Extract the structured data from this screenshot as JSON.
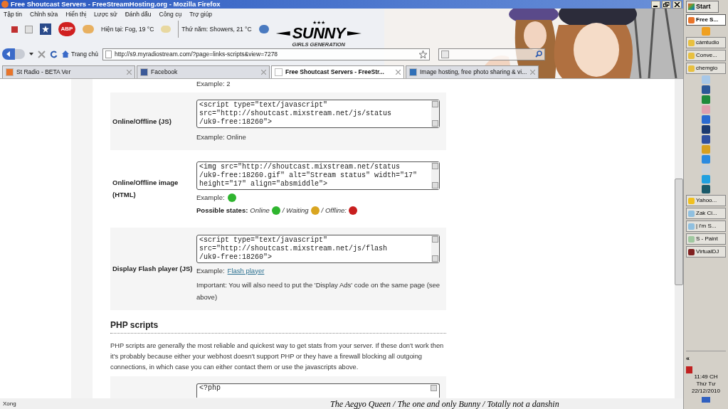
{
  "window": {
    "title": "Free Shoutcast Servers - FreeStreamHosting.org - Mozilla Firefox"
  },
  "menu": [
    "Tập tin",
    "Chỉnh sửa",
    "Hiển thị",
    "Lược sử",
    "Đánh dấu",
    "Công cụ",
    "Trợ giúp"
  ],
  "toolbar": {
    "adblock": "ABP",
    "weather_now": "Hiện tại: Fog, 19 °C",
    "weather_tomorrow": "Thứ năm: Showers, 21 °C"
  },
  "logo": {
    "stars": "★★★",
    "name": "SUNNY",
    "tagline": "GIRLS GENERATION"
  },
  "nav": {
    "home": "Trang chủ",
    "url": "http://s9.myradiostream.com/?page=links-scripts&view=7278"
  },
  "tabs": [
    {
      "label": "St Radio - BETA Ver",
      "selected": false,
      "color": "#e8742a"
    },
    {
      "label": "Facebook",
      "selected": false,
      "color": "#3b5998"
    },
    {
      "label": "Free Shoutcast Servers - FreeStr...",
      "selected": true,
      "color": "#ffffff"
    },
    {
      "label": "Image hosting, free photo sharing & vi...",
      "selected": false,
      "color": "#2f6fb8"
    }
  ],
  "page": {
    "top_note": "Example: 2",
    "rows": [
      {
        "label": "Online/Offline (JS)",
        "code": [
          "<script type=\"text/javascript\"",
          "src=\"http://shoutcast.mixstream.net/js/status",
          "/uk9-free:18260\">"
        ],
        "notes": [
          {
            "kind": "text",
            "text": "Example: Online"
          }
        ]
      },
      {
        "label": "Online/Offline image (HTML)",
        "code": [
          "<img src=\"http://shoutcast.mixstream.net/status",
          "/uk9-free:18260.gif\" alt=\"Stream status\" width=\"17\"",
          "height=\"17\" align=\"absmiddle\">"
        ],
        "notes": [
          {
            "kind": "dot",
            "text": "Example:",
            "color": "#2fb52f"
          },
          {
            "kind": "states",
            "text": "Possible states:",
            "states": [
              {
                "label": "Online",
                "color": "#2fb52f"
              },
              {
                "label": "/ Waiting",
                "color": "#d9a520"
              },
              {
                "label": "/ Offline:",
                "color": "#c81e1e"
              }
            ]
          }
        ]
      },
      {
        "label": "Display Flash player (JS)",
        "code": [
          "<script type=\"text/javascript\"",
          "src=\"http://shoutcast.mixstream.net/js/flash",
          "/uk9-free:18260\">"
        ],
        "notes": [
          {
            "kind": "link",
            "text": "Example:",
            "link": "Flash player"
          },
          {
            "kind": "text",
            "text": "Important: You will also need to put the 'Display Ads' code on the same page (see above)"
          }
        ]
      }
    ],
    "heading": "PHP scripts",
    "paragraph": "PHP scripts are generally the most reliable and quickest way to get stats from your server. If these don't work then it's probably because either your webhost doesn't support PHP or they have a firewall blocking all outgoing connections, in which case you can either contact them or use the javascripts above.",
    "last_code": "<?php"
  },
  "status_bar": {
    "text": "Xong",
    "caption": "The Aegyo Queen / The one and only Bunny / Totally not a danshin"
  },
  "taskbar": {
    "start": "Start",
    "items": [
      {
        "kind": "button",
        "label": "Free S...",
        "selected": true,
        "color": "#e8742a"
      },
      {
        "kind": "icon",
        "color": "#f0a020"
      },
      {
        "kind": "button",
        "label": "cámtudio",
        "selected": false,
        "color": "#e8c040"
      },
      {
        "kind": "button",
        "label": "Conve...",
        "selected": false,
        "color": "#e8c040"
      },
      {
        "kind": "button",
        "label": "chemgio",
        "selected": false,
        "color": "#e8c040"
      },
      {
        "kind": "icon",
        "color": "#a8c8e8"
      },
      {
        "kind": "icon",
        "color": "#2b5797"
      },
      {
        "kind": "icon",
        "color": "#1f8a3c"
      },
      {
        "kind": "icon",
        "color": "#e0a0b0"
      },
      {
        "kind": "icon",
        "color": "#2a6ad0"
      },
      {
        "kind": "icon",
        "color": "#1c3a70"
      },
      {
        "kind": "icon",
        "color": "#3050a0"
      },
      {
        "kind": "icon",
        "color": "#d8a020"
      },
      {
        "kind": "icon",
        "color": "#2a8ae0"
      },
      {
        "kind": "icon",
        "color": "#c8d0d8"
      },
      {
        "kind": "icon",
        "color": "#20a0e0"
      },
      {
        "kind": "icon",
        "color": "#1a5a6a"
      },
      {
        "kind": "button",
        "label": "Yahoo...",
        "selected": false,
        "color": "#f0c020"
      },
      {
        "kind": "button",
        "label": "Zak Ci...",
        "selected": false,
        "color": "#90c0e0"
      },
      {
        "kind": "button",
        "label": "| i'm S...",
        "selected": false,
        "color": "#90c0e0"
      },
      {
        "kind": "button",
        "label": "S - Paint",
        "selected": false,
        "color": "#a0c8a0"
      },
      {
        "kind": "button",
        "label": "VirtualDJ",
        "selected": false,
        "color": "#802020"
      }
    ],
    "tray": {
      "expand": "«",
      "time": "11:49 CH",
      "day": "Thứ Tư",
      "date": "22/12/2010"
    }
  }
}
